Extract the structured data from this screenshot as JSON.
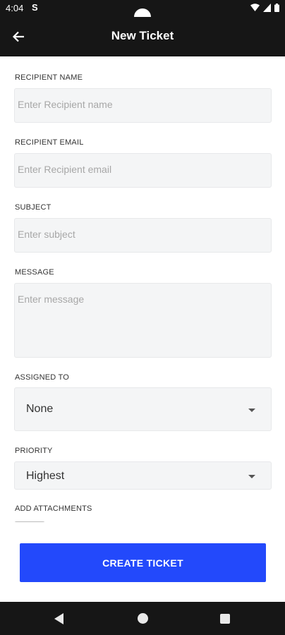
{
  "status": {
    "time": "4:04",
    "app_icon_text": "S"
  },
  "header": {
    "title": "New Ticket"
  },
  "form": {
    "recipient_name": {
      "label": "RECIPIENT NAME",
      "placeholder": "Enter Recipient name"
    },
    "recipient_email": {
      "label": "RECIPIENT EMAIL",
      "placeholder": "Enter Recipient email"
    },
    "subject": {
      "label": "SUBJECT",
      "placeholder": "Enter subject"
    },
    "message": {
      "label": "MESSAGE",
      "placeholder": "Enter message"
    },
    "assigned_to": {
      "label": "ASSIGNED TO",
      "value": "None"
    },
    "priority": {
      "label": "PRIORITY",
      "value": "Highest"
    },
    "attachments": {
      "label": "ADD ATTACHMENTS"
    }
  },
  "actions": {
    "create_label": "CREATE TICKET"
  },
  "colors": {
    "primary": "#2349fb",
    "bar": "#161616",
    "field_bg": "#f4f5f6"
  }
}
